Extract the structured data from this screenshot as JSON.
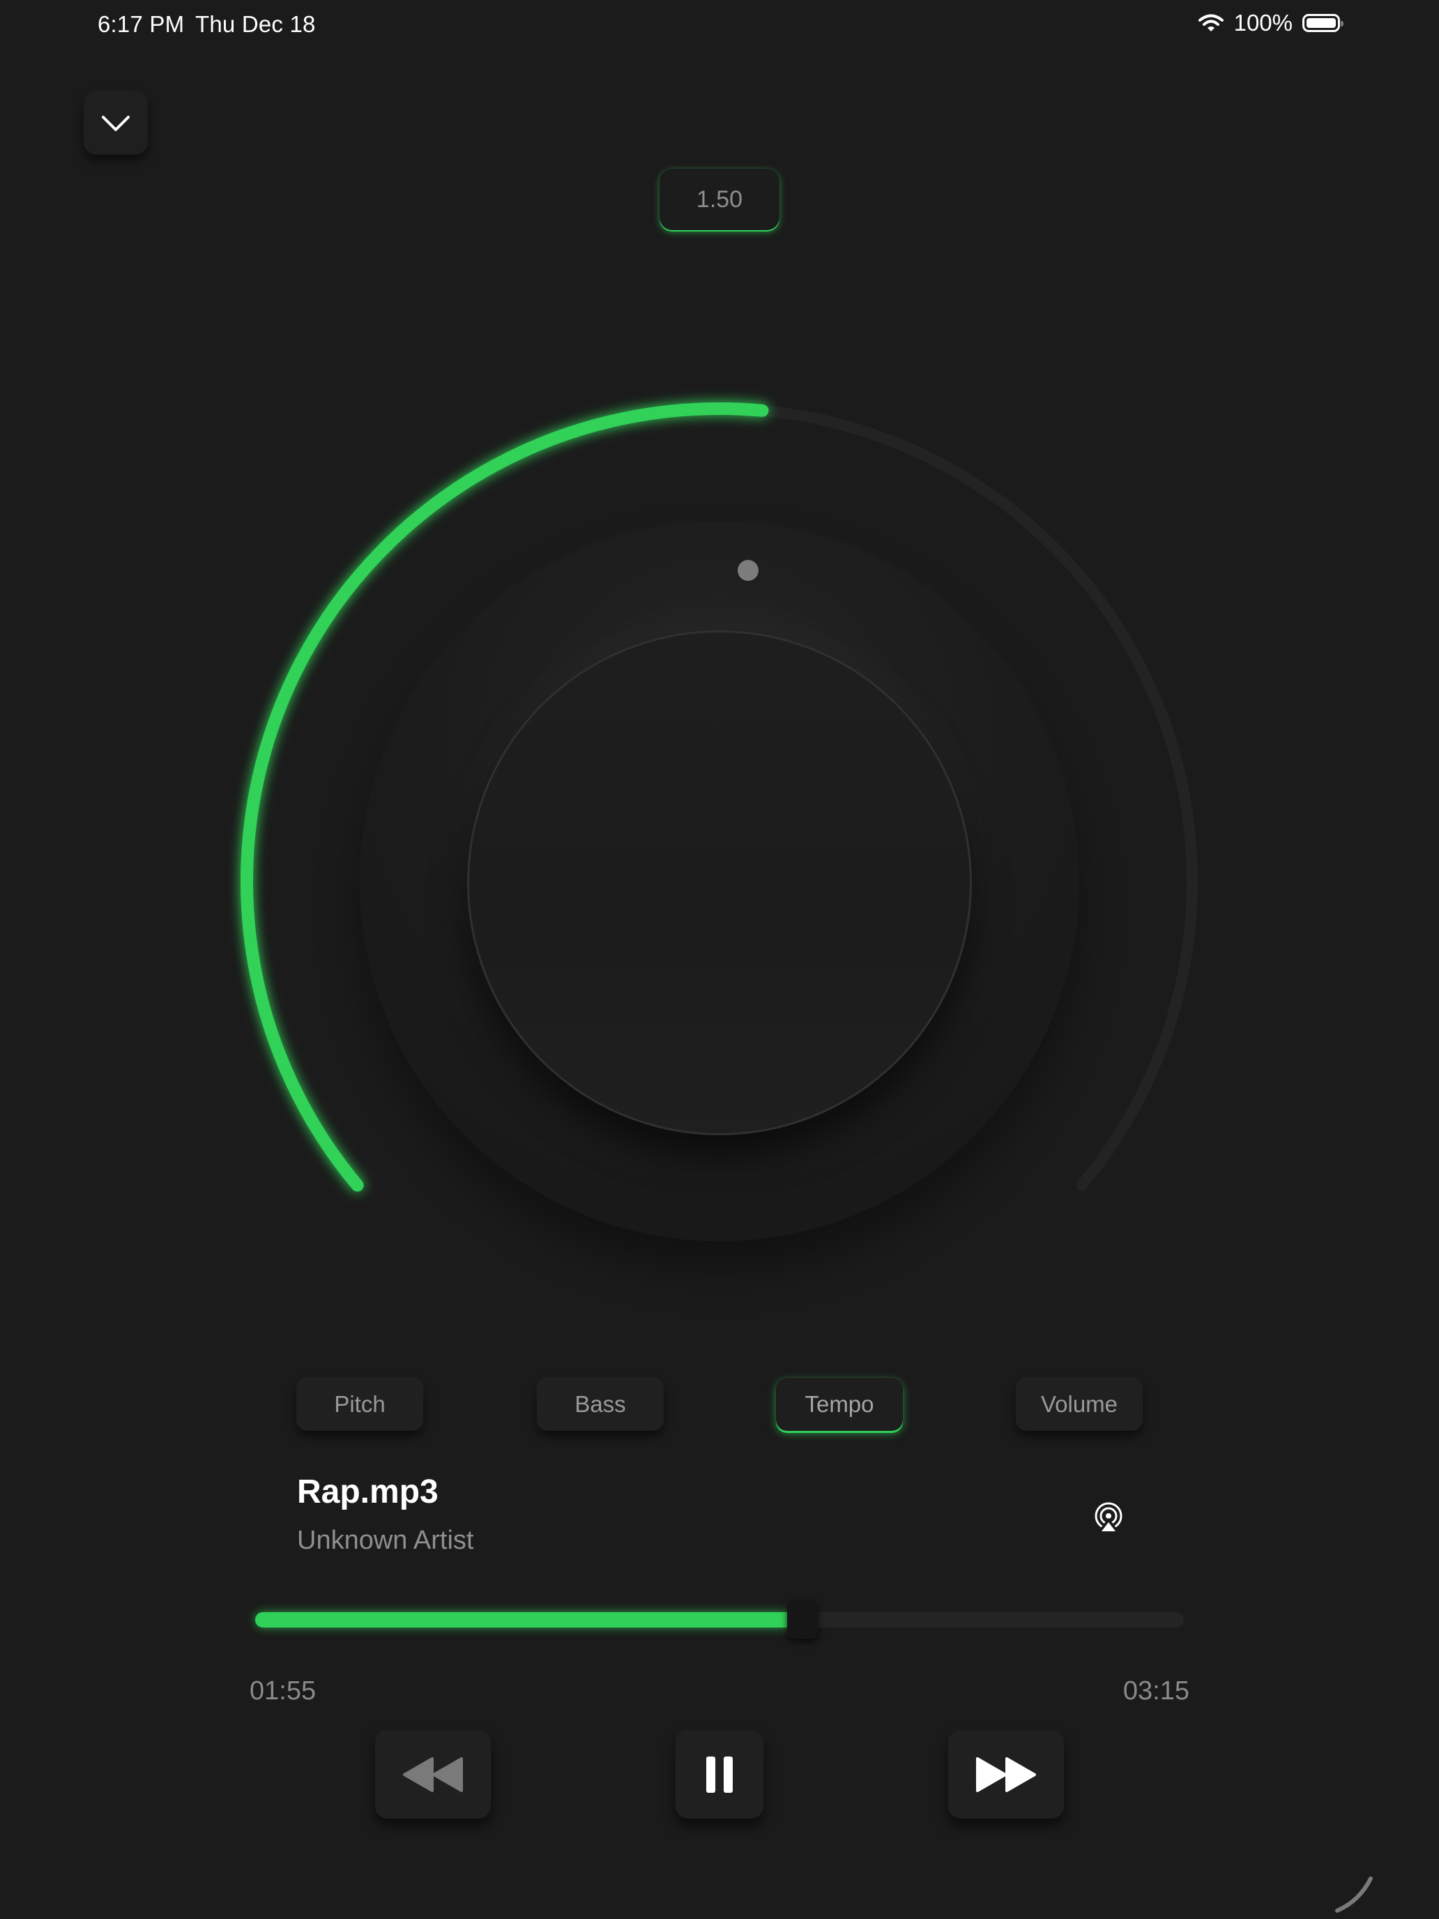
{
  "status_bar": {
    "time": "6:17 PM",
    "date": "Thu Dec 18",
    "battery": "100%",
    "battery_level": 1.0,
    "wifi_icon": "wifi-icon",
    "battery_icon": "battery-icon"
  },
  "header": {
    "collapse_icon": "chevron-down-icon",
    "value_readout": "1.50"
  },
  "knob": {
    "level": 0.52,
    "active_color": "#30d158",
    "track_color": "#232323"
  },
  "modes": [
    {
      "label": "Pitch",
      "active": false
    },
    {
      "label": "Bass",
      "active": false
    },
    {
      "label": "Tempo",
      "active": true
    },
    {
      "label": "Volume",
      "active": false
    }
  ],
  "track": {
    "title": "Rap.mp3",
    "artist": "Unknown Artist",
    "airplay_icon": "airplay-icon"
  },
  "playback": {
    "elapsed": "01:55",
    "total": "03:15",
    "progress": 0.5897,
    "accent": "#30d158"
  },
  "transport": {
    "rewind_icon": "rewind-icon",
    "pause_icon": "pause-icon",
    "forward_icon": "fast-forward-icon"
  }
}
